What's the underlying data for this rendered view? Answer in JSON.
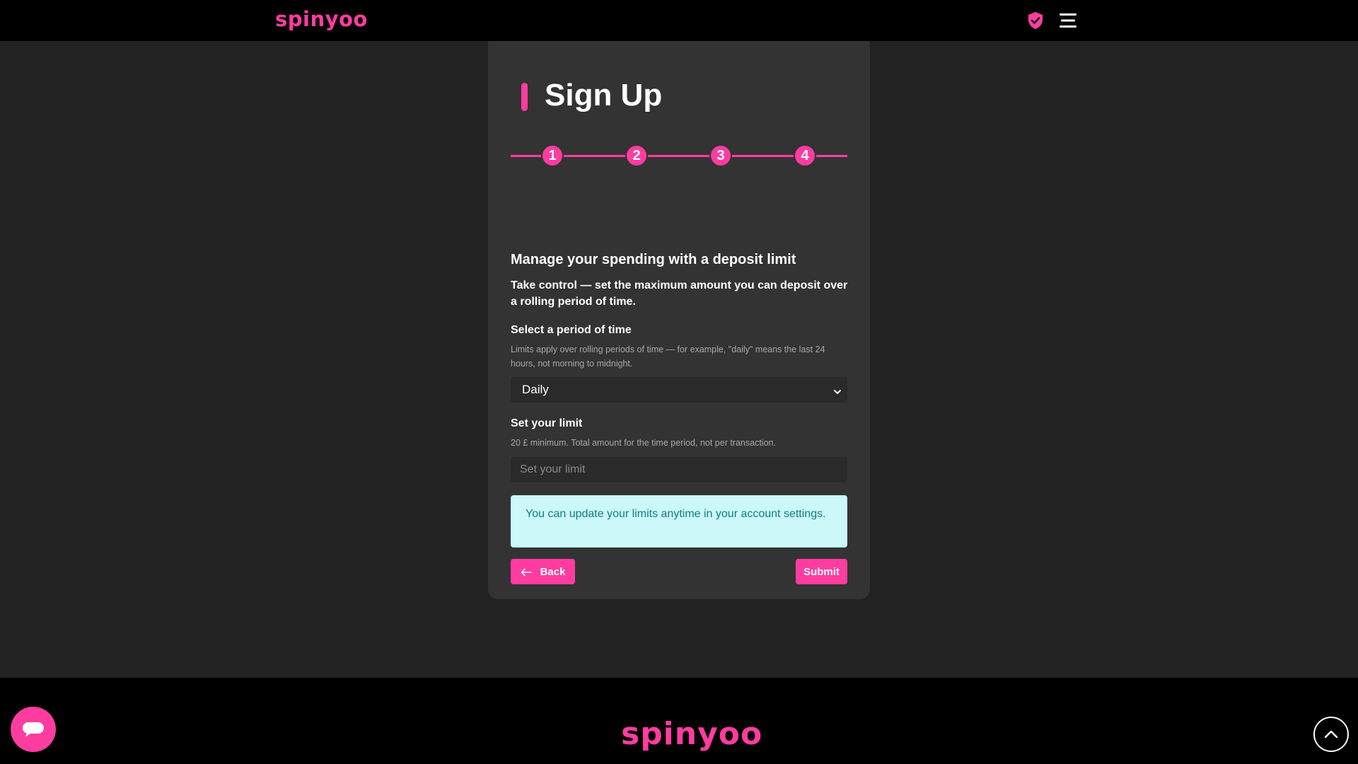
{
  "header": {
    "logo": "spinyoo"
  },
  "form": {
    "title": "Sign Up",
    "steps": [
      "1",
      "2",
      "3",
      "4"
    ],
    "heading": "Manage your spending with a deposit limit",
    "intro": "Take control — set the maximum amount you can deposit over a rolling period of time.",
    "period": {
      "label": "Select a period of time",
      "hint": "Limits apply over rolling periods of time — for example, \"daily\" means the last 24 hours, not morning to midnight.",
      "selected": "Daily"
    },
    "limit": {
      "label": "Set your limit",
      "hint": "20 £ minimum. Total amount for the time period, not per transaction.",
      "placeholder": "Set your limit"
    },
    "info": "You can update your limits anytime in your account settings.",
    "back_label": "Back",
    "submit_label": "Submit"
  },
  "footer": {
    "logo": "spinyoo"
  },
  "colors": {
    "accent": "#ff3ca0",
    "background": "#222222",
    "card": "#333333",
    "info_bg": "#ccf8fa",
    "info_text": "#0e7d87"
  },
  "icons": {
    "shield": "shield-check-icon",
    "menu": "hamburger-menu-icon",
    "chat": "chat-bubble-icon",
    "scroll_top": "chevron-up-icon",
    "back": "arrow-left-icon",
    "select": "chevron-down-icon"
  }
}
